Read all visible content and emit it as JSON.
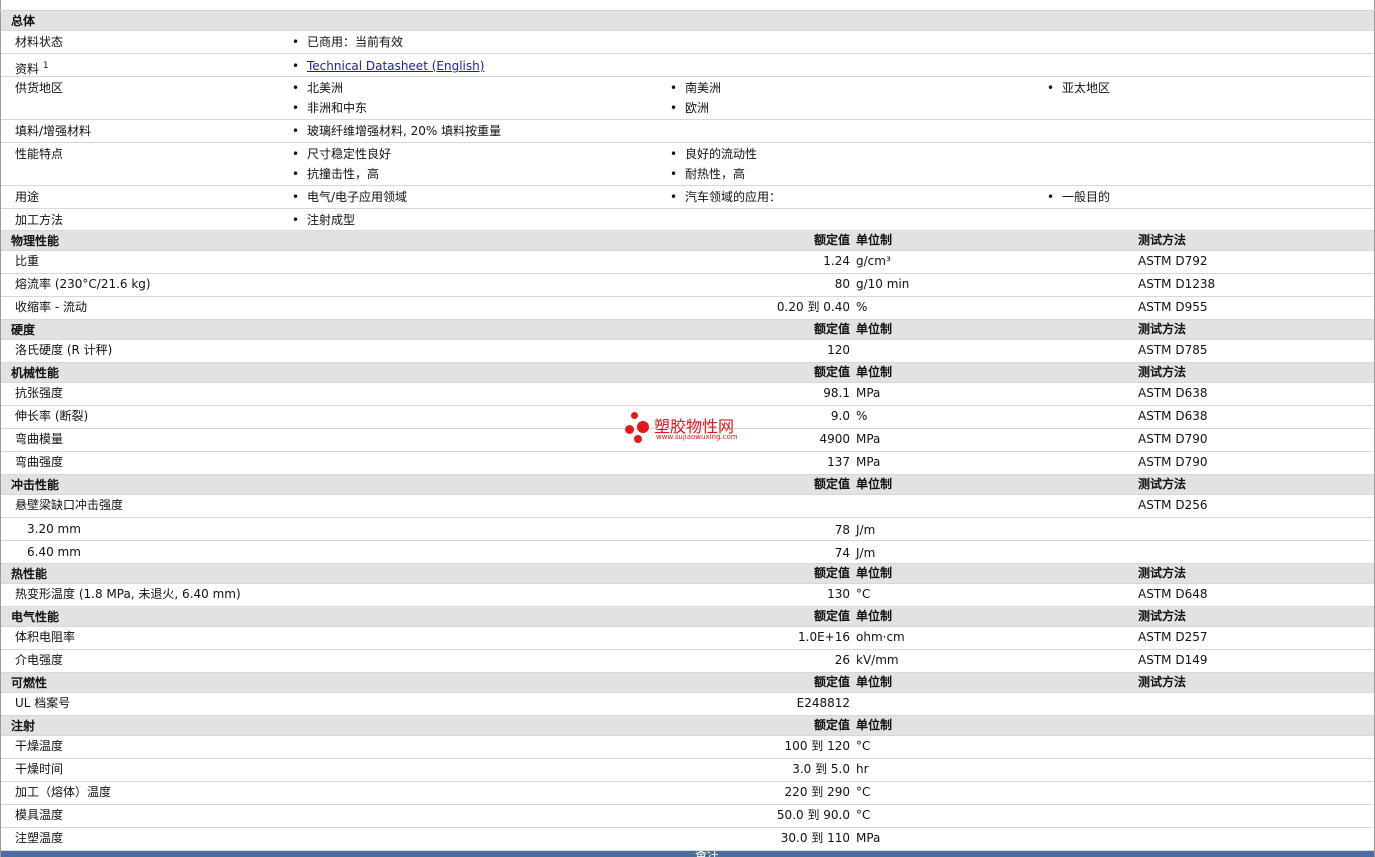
{
  "general": {
    "title": "总体",
    "status_label": "材料状态",
    "status_value": "已商用：当前有效",
    "literature_label": "资料",
    "literature_sup": "1",
    "literature_link": "Technical Datasheet (English)",
    "availability_label": "供货地区",
    "availability": [
      "北美洲",
      "南美洲",
      "亚太地区",
      "非洲和中东",
      "欧洲"
    ],
    "filler_label": "填料/增强材料",
    "filler_value": "玻璃纤维增强材料, 20% 填料按重量",
    "features_label": "性能特点",
    "features": [
      "尺寸稳定性良好",
      "良好的流动性",
      "抗撞击性，高",
      "耐热性，高"
    ],
    "uses_label": "用途",
    "uses": [
      "电气/电子应用领域",
      "汽车领域的应用：",
      "一般目的"
    ],
    "processing_label": "加工方法",
    "processing_value": "注射成型"
  },
  "headers": {
    "nominal": "额定值",
    "unit": "单位制",
    "method": "测试方法"
  },
  "sections": [
    {
      "title": "物理性能",
      "method": true,
      "rows": [
        {
          "name": "比重",
          "value": "1.24",
          "unit": "g/cm³",
          "method": "ASTM D792"
        },
        {
          "name": "熔流率  (230°C/21.6 kg)",
          "value": "80",
          "unit": "g/10 min",
          "method": "ASTM D1238"
        },
        {
          "name": "收缩率  - 流动",
          "value": "0.20 到  0.40",
          "unit": "%",
          "method": "ASTM D955"
        }
      ]
    },
    {
      "title": "硬度",
      "method": true,
      "rows": [
        {
          "name": "洛氏硬度  (R 计秤)",
          "value": "120",
          "unit": "",
          "method": "ASTM D785"
        }
      ]
    },
    {
      "title": "机械性能",
      "method": true,
      "rows": [
        {
          "name": "抗张强度",
          "value": "98.1",
          "unit": "MPa",
          "method": "ASTM D638"
        },
        {
          "name": "伸长率  (断裂)",
          "value": "9.0",
          "unit": "%",
          "method": "ASTM D638"
        },
        {
          "name": "弯曲模量",
          "value": "4900",
          "unit": "MPa",
          "method": "ASTM D790"
        },
        {
          "name": "弯曲强度",
          "value": "137",
          "unit": "MPa",
          "method": "ASTM D790"
        }
      ]
    },
    {
      "title": "冲击性能",
      "method": true,
      "rows": [
        {
          "name": "悬壁梁缺口冲击强度",
          "value": "",
          "unit": "",
          "method": "ASTM D256"
        },
        {
          "name": "3.20 mm",
          "value": "78",
          "unit": "J/m",
          "method": "",
          "sub": true
        },
        {
          "name": "6.40 mm",
          "value": "74",
          "unit": "J/m",
          "method": "",
          "sub": true
        }
      ]
    },
    {
      "title": "热性能",
      "method": true,
      "rows": [
        {
          "name": "热变形温度  (1.8 MPa, 未退火, 6.40 mm)",
          "value": "130",
          "unit": "°C",
          "method": "ASTM D648"
        }
      ]
    },
    {
      "title": "电气性能",
      "method": true,
      "rows": [
        {
          "name": "体积电阻率",
          "value": "1.0E+16",
          "unit": "ohm·cm",
          "method": "ASTM D257"
        },
        {
          "name": "介电强度",
          "value": "26",
          "unit": "kV/mm",
          "method": "ASTM D149"
        }
      ]
    },
    {
      "title": "可燃性",
      "method": true,
      "rows": [
        {
          "name": "UL 档案号",
          "value": "E248812",
          "unit": "",
          "method": ""
        }
      ]
    },
    {
      "title": "注射",
      "method": false,
      "rows": [
        {
          "name": "干燥温度",
          "value": "100 到  120",
          "unit": "°C",
          "method": ""
        },
        {
          "name": "干燥时间",
          "value": "3.0 到  5.0",
          "unit": "hr",
          "method": ""
        },
        {
          "name": "加工（熔体）温度",
          "value": "220 到  290",
          "unit": "°C",
          "method": ""
        },
        {
          "name": "模具温度",
          "value": "50.0 到  90.0",
          "unit": "°C",
          "method": ""
        },
        {
          "name": "注塑温度",
          "value": "30.0 到  110",
          "unit": "MPa",
          "method": ""
        }
      ]
    }
  ],
  "watermark": {
    "title": "塑胶物性网",
    "url": "www.sujiaowuxing.com"
  },
  "footer": {
    "label": "备注"
  }
}
